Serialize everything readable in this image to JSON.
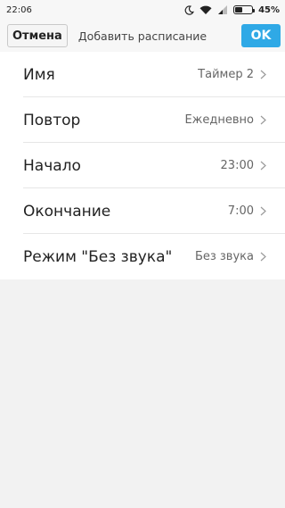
{
  "status_bar": {
    "time": "22:06",
    "icons": [
      "moon-icon",
      "wifi-icon",
      "signal-icon",
      "battery-icon"
    ],
    "battery_level": 0.45,
    "battery_percent": "45%"
  },
  "header": {
    "cancel_label": "Отмена",
    "title": "Добавить расписание",
    "ok_label": "OK",
    "accent_color": "#2fa9e6"
  },
  "settings": {
    "items": [
      {
        "label": "Имя",
        "value": "Таймер 2"
      },
      {
        "label": "Повтор",
        "value": "Ежедневно"
      },
      {
        "label": "Начало",
        "value": "23:00"
      },
      {
        "label": "Окончание",
        "value": "7:00"
      },
      {
        "label": "Режим \"Без звука\"",
        "value": "Без звука"
      }
    ]
  }
}
